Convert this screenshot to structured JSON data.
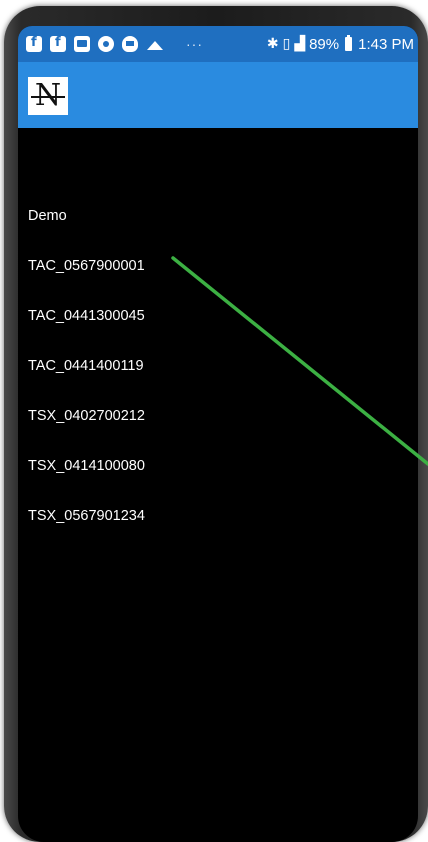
{
  "status_bar": {
    "notification_icons": [
      "facebook-icon",
      "facebook-icon",
      "message-icon",
      "chrome-icon",
      "shield-icon",
      "mountain-icon"
    ],
    "overflow": "···",
    "system_icons": [
      "bluetooth-icon",
      "vibrate-icon",
      "signal-icon"
    ],
    "battery": "89%",
    "time": "1:43 PM"
  },
  "app_bar": {
    "logo_letter": "N",
    "background_color": "#2a8be0"
  },
  "list": {
    "items": [
      {
        "label": "Demo"
      },
      {
        "label": "TAC_0567900001"
      },
      {
        "label": "TAC_0441300045"
      },
      {
        "label": "TAC_0441400119"
      },
      {
        "label": "TSX_0402700212"
      },
      {
        "label": "TSX_0414100080"
      },
      {
        "label": "TSX_0567901234"
      }
    ]
  },
  "colors": {
    "screen_background": "#000000",
    "status_bar": "#1f6fc0",
    "app_bar": "#2a8be0",
    "annotation_line": "#3cb043",
    "text": "#ffffff"
  }
}
